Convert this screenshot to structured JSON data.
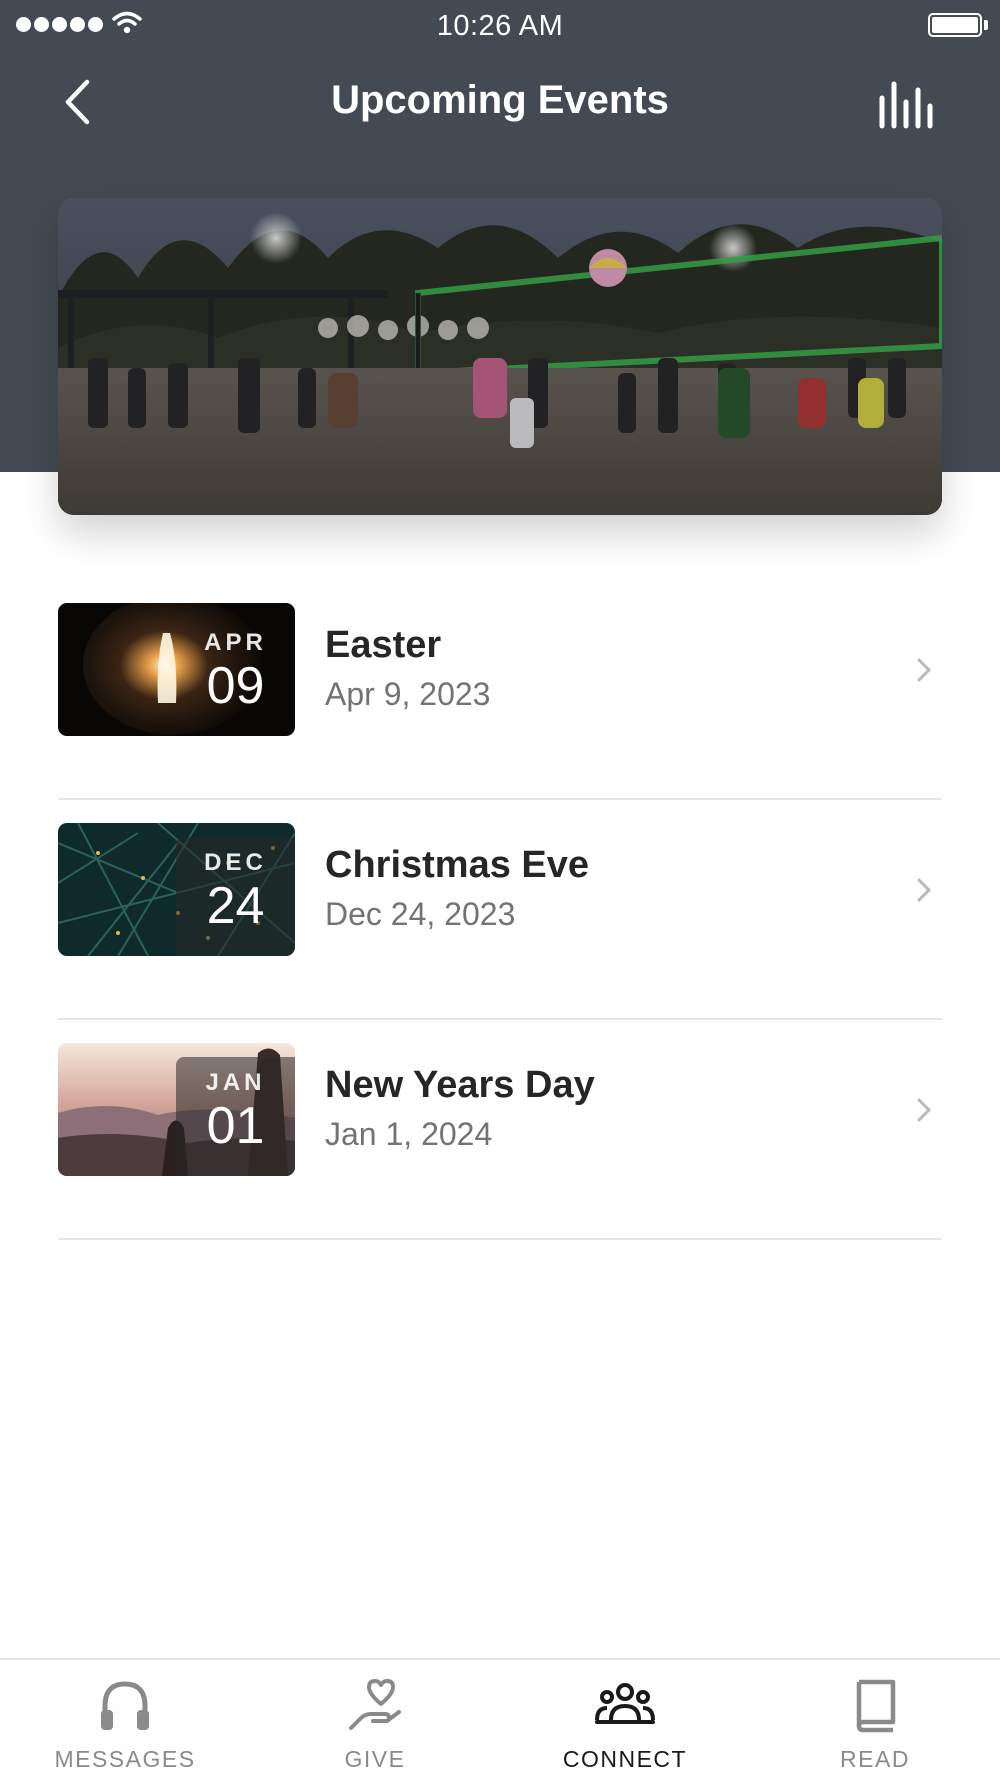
{
  "status_bar": {
    "time": "10:26 AM"
  },
  "header": {
    "title": "Upcoming Events"
  },
  "events": [
    {
      "title": "Easter",
      "date": "Apr 9, 2023",
      "month": "APR",
      "day": "09"
    },
    {
      "title": "Christmas Eve",
      "date": "Dec 24, 2023",
      "month": "DEC",
      "day": "24"
    },
    {
      "title": "New Years Day",
      "date": "Jan 1, 2024",
      "month": "JAN",
      "day": "01"
    }
  ],
  "tabs": [
    {
      "label": "MESSAGES",
      "icon": "headphones-icon",
      "active": false
    },
    {
      "label": "GIVE",
      "icon": "heart-hand-icon",
      "active": false
    },
    {
      "label": "CONNECT",
      "icon": "people-icon",
      "active": true
    },
    {
      "label": "READ",
      "icon": "book-icon",
      "active": false
    }
  ],
  "colors": {
    "header_bg": "#434a53",
    "active_tab": "#1a1a1a",
    "inactive_tab": "#8a8a8a",
    "date_text": "#737373"
  }
}
